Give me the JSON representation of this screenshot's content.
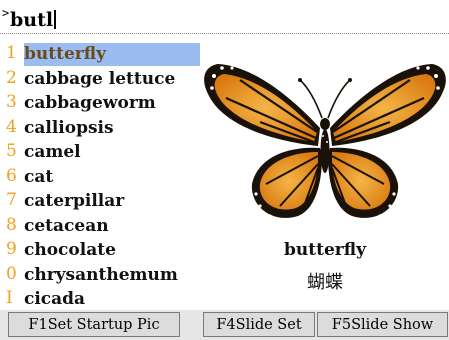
{
  "search": {
    "prompt": ">",
    "query": "butl"
  },
  "word_list": {
    "selected_index": 0,
    "items": [
      {
        "num": "1",
        "label": "butterfly"
      },
      {
        "num": "2",
        "label": "cabbage lettuce"
      },
      {
        "num": "3",
        "label": "cabbageworm"
      },
      {
        "num": "4",
        "label": "calliopsis"
      },
      {
        "num": "5",
        "label": "camel"
      },
      {
        "num": "6",
        "label": "cat"
      },
      {
        "num": "7",
        "label": "caterpillar"
      },
      {
        "num": "8",
        "label": "cetacean"
      },
      {
        "num": "9",
        "label": "chocolate"
      },
      {
        "num": "0",
        "label": "chrysanthemum"
      },
      {
        "num": "I",
        "label": "cicada"
      }
    ]
  },
  "preview": {
    "image_subject": "monarch-butterfly",
    "word": "butterfly",
    "translation": "蝴蝶"
  },
  "toolbar": {
    "set_startup_pic": "F1Set Startup Pic",
    "slide_set": "F4Slide Set",
    "slide_show": "F5Slide Show"
  },
  "colors": {
    "selection": "#9bbcf0",
    "number_accent": "#f2a01c",
    "wing_orange": "#e8901a",
    "wing_black": "#1a1208"
  }
}
